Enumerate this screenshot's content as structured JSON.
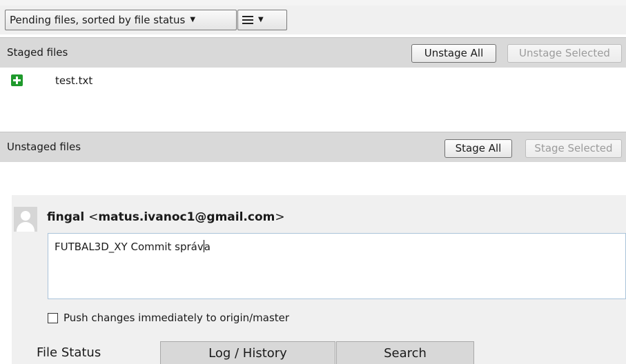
{
  "toolbar": {
    "sort_dropdown": "Pending files, sorted by file status",
    "view_dropdown_icon": "list-lines-icon"
  },
  "staged": {
    "title": "Staged files",
    "unstage_all": "Unstage All",
    "unstage_selected": "Unstage Selected",
    "files": [
      {
        "name": "test.txt",
        "status_icon": "added-plus-icon",
        "status_color": "#1f9a2c"
      }
    ]
  },
  "unstaged": {
    "title": "Unstaged files",
    "stage_all": "Stage All",
    "stage_selected": "Stage Selected"
  },
  "commit": {
    "author_name": "fingal",
    "author_email_open": "<",
    "author_email": "matus.ivanoc1@gmail.com",
    "author_email_close": ">",
    "message_before_caret": "FUTBAL3D_XY Commit správ",
    "message_after_caret": "a",
    "push_label": "Push changes immediately to origin/master",
    "push_checked": false
  },
  "tabs": [
    {
      "label": "File Status",
      "active": true
    },
    {
      "label": "Log / History",
      "active": false
    },
    {
      "label": "Search",
      "active": false
    }
  ]
}
